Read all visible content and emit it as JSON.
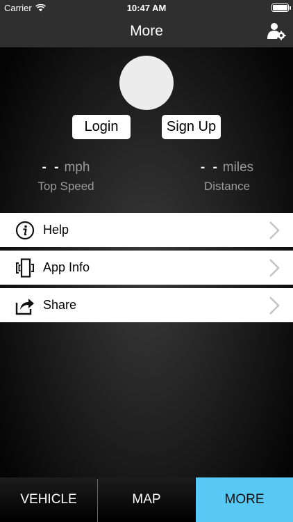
{
  "status_bar": {
    "carrier": "Carrier",
    "time": "10:47 AM",
    "battery_level": 1.0
  },
  "nav": {
    "title": "More",
    "right_icon": "profile-settings-icon"
  },
  "profile": {
    "login_label": "Login",
    "signup_label": "Sign Up"
  },
  "stats": {
    "top_speed": {
      "value": "- -",
      "unit": "mph",
      "label": "Top Speed"
    },
    "distance": {
      "value": "- -",
      "unit": "miles",
      "label": "Distance"
    }
  },
  "menu": [
    {
      "label": "Help",
      "icon": "info-icon"
    },
    {
      "label": "App Info",
      "icon": "app-info-icon"
    },
    {
      "label": "Share",
      "icon": "share-icon"
    }
  ],
  "tabs": [
    {
      "label": "VEHICLE",
      "selected": false
    },
    {
      "label": "MAP",
      "selected": false
    },
    {
      "label": "MORE",
      "selected": true
    }
  ],
  "colors": {
    "accent": "#58c8f5",
    "bar": "#2f2f2f"
  }
}
